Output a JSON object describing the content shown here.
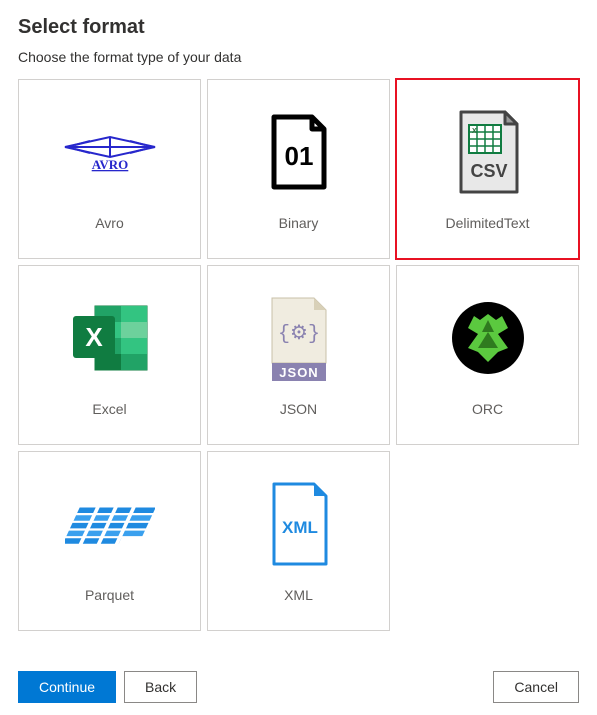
{
  "title": "Select format",
  "subtitle": "Choose the format type of your data",
  "formats": [
    {
      "label": "Avro"
    },
    {
      "label": "Binary"
    },
    {
      "label": "DelimitedText"
    },
    {
      "label": "Excel"
    },
    {
      "label": "JSON"
    },
    {
      "label": "ORC"
    },
    {
      "label": "Parquet"
    },
    {
      "label": "XML"
    }
  ],
  "selected_index": 2,
  "buttons": {
    "continue": "Continue",
    "back": "Back",
    "cancel": "Cancel"
  }
}
